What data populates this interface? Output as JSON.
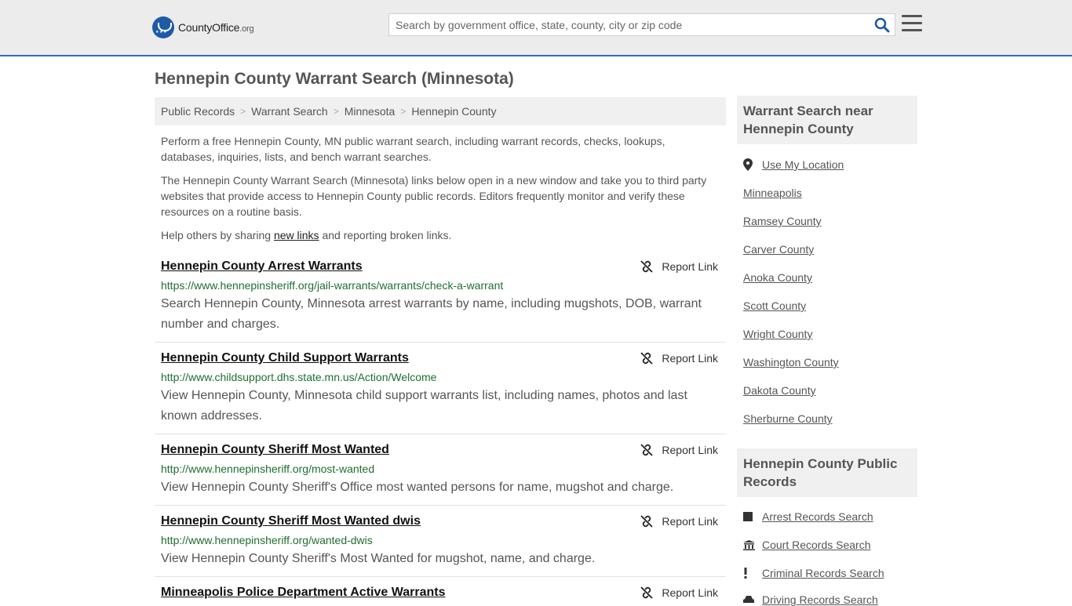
{
  "header": {
    "logo_main": "CountyOffice",
    "logo_suffix": ".org",
    "search_placeholder": "Search by government office, state, county, city or zip code"
  },
  "page_title": "Hennepin County Warrant Search (Minnesota)",
  "breadcrumb": [
    "Public Records",
    "Warrant Search",
    "Minnesota",
    "Hennepin County"
  ],
  "intro": {
    "p1": "Perform a free Hennepin County, MN public warrant search, including warrant records, checks, lookups, databases, inquiries, lists, and bench warrant searches.",
    "p2": "The Hennepin County Warrant Search (Minnesota) links below open in a new window and take you to third party websites that provide access to Hennepin County public records. Editors frequently monitor and verify these resources on a routine basis.",
    "p3_before": "Help others by sharing ",
    "p3_link": "new links",
    "p3_after": " and reporting broken links."
  },
  "report_label": "Report Link",
  "results": [
    {
      "title": "Hennepin County Arrest Warrants",
      "url": "https://www.hennepinsheriff.org/jail-warrants/warrants/check-a-warrant",
      "desc": "Search Hennepin County, Minnesota arrest warrants by name, including mugshots, DOB, warrant number and charges."
    },
    {
      "title": "Hennepin County Child Support Warrants",
      "url": "http://www.childsupport.dhs.state.mn.us/Action/Welcome",
      "desc": "View Hennepin County, Minnesota child support warrants list, including names, photos and last known addresses."
    },
    {
      "title": "Hennepin County Sheriff Most Wanted",
      "url": "http://www.hennepinsheriff.org/most-wanted",
      "desc": "View Hennepin County Sheriff's Office most wanted persons for name, mugshot and charge."
    },
    {
      "title": "Hennepin County Sheriff Most Wanted dwis",
      "url": "http://www.hennepinsheriff.org/wanted-dwis",
      "desc": "View Hennepin County Sheriff's Most Wanted for mugshot, name, and charge."
    },
    {
      "title": "Minneapolis Police Department Active Warrants",
      "url": "",
      "desc": ""
    }
  ],
  "sidebar": {
    "nearby_heading": "Warrant Search near Hennepin County",
    "use_location": "Use My Location",
    "nearby": [
      "Minneapolis",
      "Ramsey County",
      "Carver County",
      "Anoka County",
      "Scott County",
      "Wright County",
      "Washington County",
      "Dakota County",
      "Sherburne County"
    ],
    "records_heading": "Hennepin County Public Records",
    "records": [
      {
        "label": "Arrest Records Search",
        "icon": "square-icon"
      },
      {
        "label": "Court Records Search",
        "icon": "courthouse-icon"
      },
      {
        "label": "Criminal Records Search",
        "icon": "exclamation-icon"
      },
      {
        "label": "Driving Records Search",
        "icon": "car-icon"
      }
    ]
  },
  "colors": {
    "accent": "#2e6fb3",
    "url_green": "#1f6f2f",
    "header_bg": "#ececec"
  }
}
